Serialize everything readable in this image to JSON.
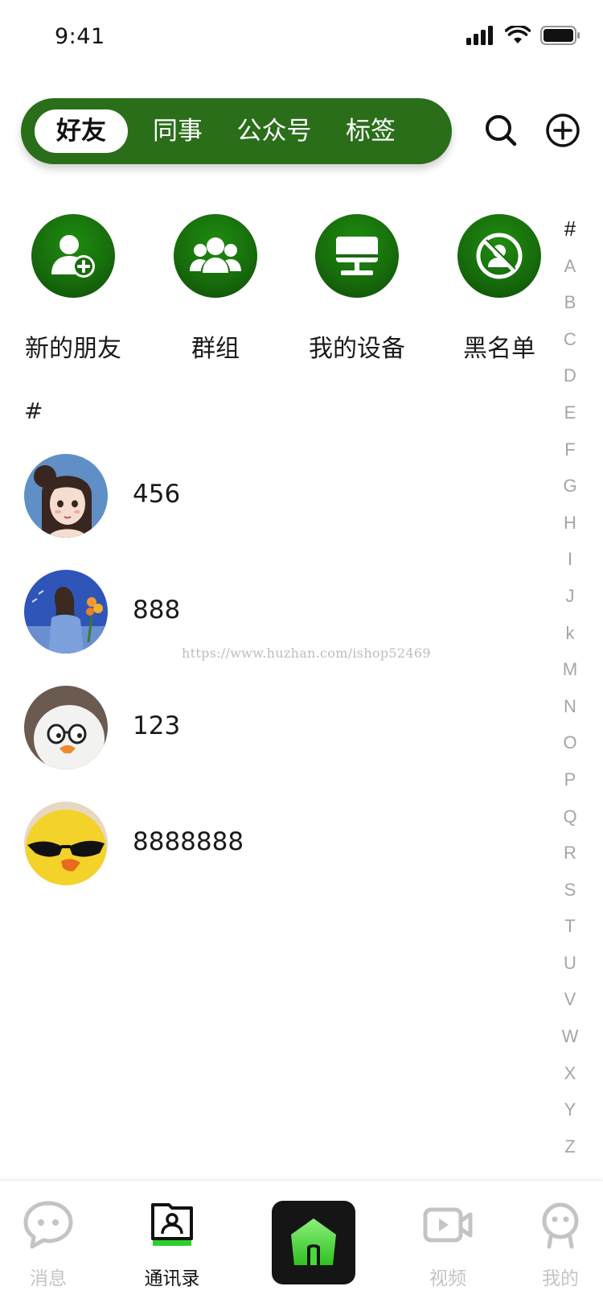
{
  "status": {
    "time": "9:41"
  },
  "header": {
    "tabs": [
      {
        "label": "好友",
        "active": true
      },
      {
        "label": "同事",
        "active": false
      },
      {
        "label": "公众号",
        "active": false
      },
      {
        "label": "标签",
        "active": false
      }
    ],
    "search_icon": "search-icon",
    "add_icon": "plus-circle-icon"
  },
  "shortcuts": [
    {
      "label": "新的朋友",
      "icon": "add-friend-icon"
    },
    {
      "label": "群组",
      "icon": "group-icon"
    },
    {
      "label": "我的设备",
      "icon": "device-icon"
    },
    {
      "label": "黑名单",
      "icon": "blocked-user-icon"
    }
  ],
  "section_label": "#",
  "contacts": [
    {
      "name": "456"
    },
    {
      "name": "888"
    },
    {
      "name": "123"
    },
    {
      "name": "8888888"
    }
  ],
  "watermark": "https://www.huzhan.com/ishop52469",
  "index_letters": [
    "#",
    "A",
    "B",
    "C",
    "D",
    "E",
    "F",
    "G",
    "H",
    "I",
    "J",
    "k",
    "M",
    "N",
    "O",
    "P",
    "Q",
    "R",
    "S",
    "T",
    "U",
    "V",
    "W",
    "X",
    "Y",
    "Z"
  ],
  "tabbar": {
    "messages": "消息",
    "contacts": "通讯录",
    "video": "视频",
    "me": "我的"
  },
  "colors": {
    "accent": "#2b6e1a",
    "shortcut_green": "#176d0c",
    "inactive_text": "#c4c4c4",
    "home_button": "#151515",
    "home_icon": "#48d83a"
  }
}
